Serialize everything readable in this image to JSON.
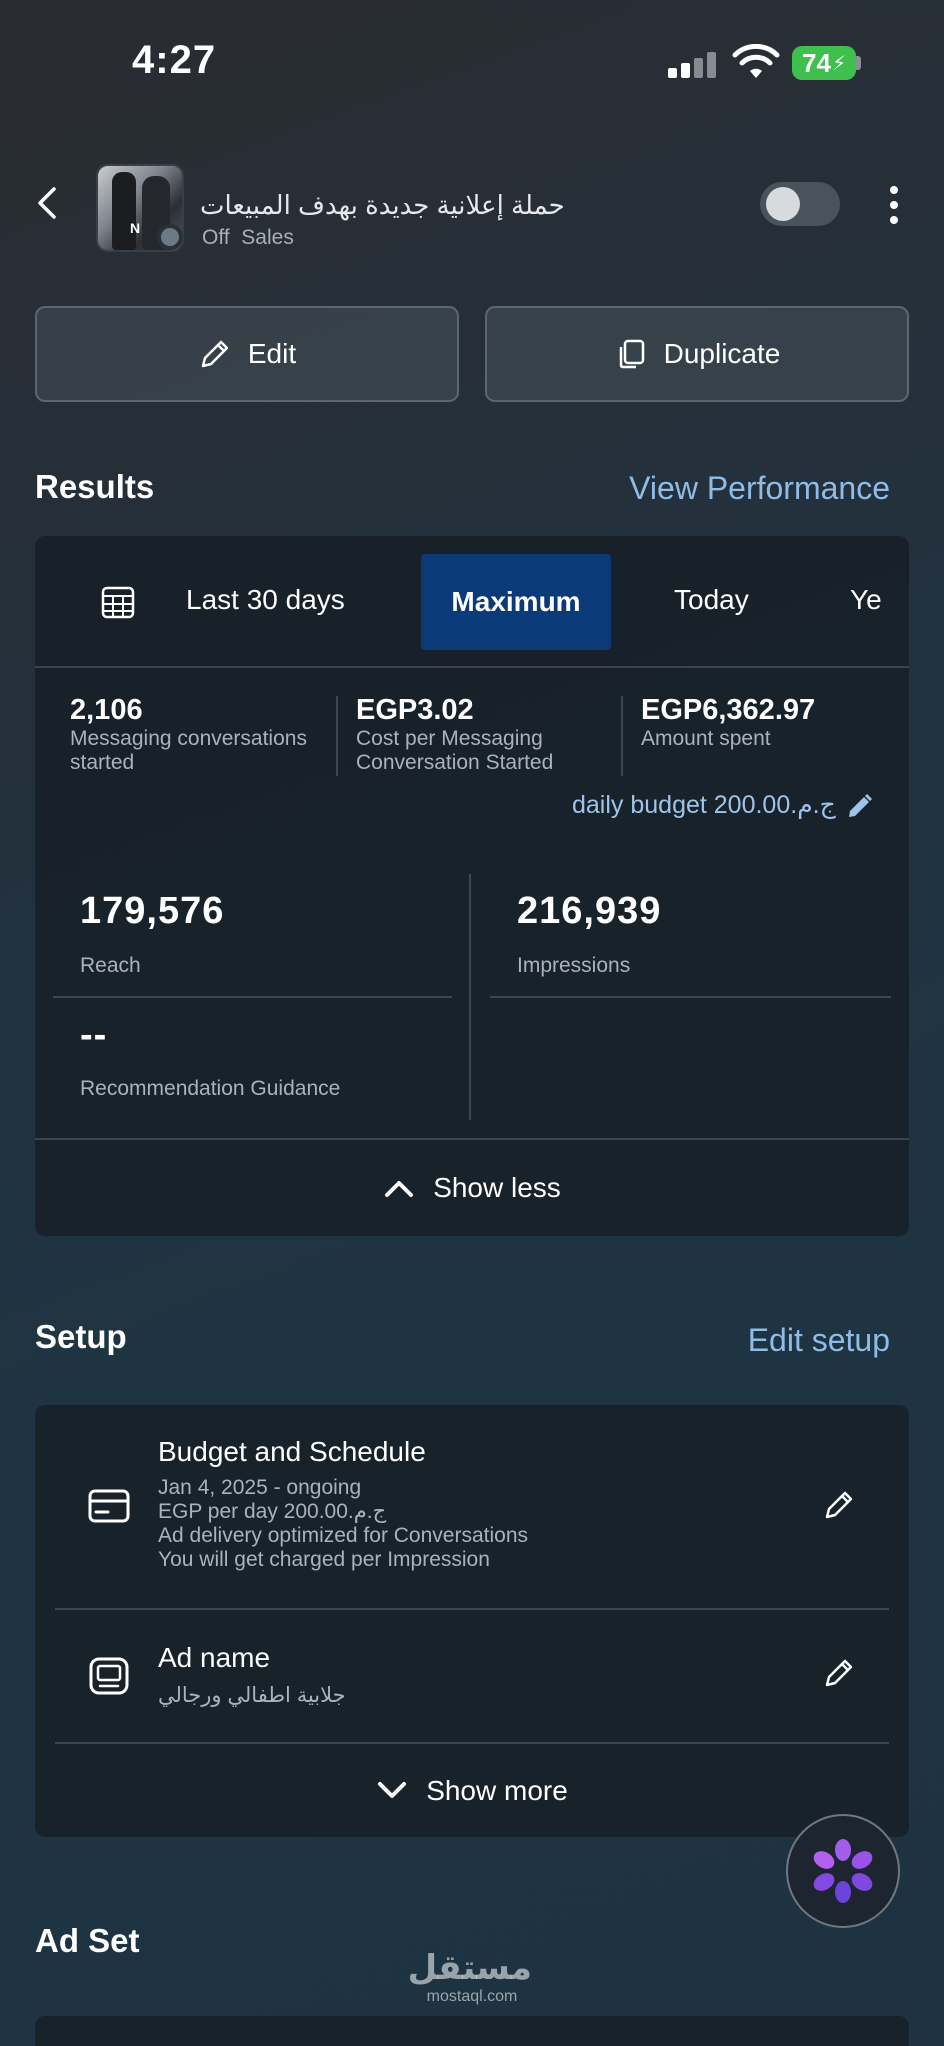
{
  "status_bar": {
    "time": "4:27",
    "battery": "74"
  },
  "header": {
    "campaign_title": "حملة إعلانية جديدة بهدف المبيعات",
    "campaign_status": "Off",
    "campaign_objective": "Sales"
  },
  "actions": {
    "edit_label": "Edit",
    "duplicate_label": "Duplicate"
  },
  "results": {
    "title": "Results",
    "view_performance": "View Performance",
    "tabs": [
      "Last 30 days",
      "Maximum",
      "Today",
      "Ye"
    ],
    "active_tab": "Maximum",
    "metrics": [
      {
        "value": "2,106",
        "label_1": "Messaging conversations",
        "label_2": "started"
      },
      {
        "value": "EGP3.02",
        "label_1": "Cost per Messaging",
        "label_2": "Conversation Started"
      },
      {
        "value": "EGP6,362.97",
        "label_1": "Amount spent",
        "label_2": ""
      }
    ],
    "daily_budget": "daily budget 200.00.ج.م",
    "reach": {
      "value": "179,576",
      "label": "Reach"
    },
    "impressions": {
      "value": "216,939",
      "label": "Impressions"
    },
    "recommendation": {
      "value": "--",
      "label": "Recommendation Guidance"
    },
    "show_less": "Show less"
  },
  "setup": {
    "title": "Setup",
    "edit_setup": "Edit setup",
    "budget": {
      "title": "Budget and Schedule",
      "line_1": "Jan 4, 2025 - ongoing",
      "line_2": "EGP per day 200.00.ج.م",
      "line_3": "Ad delivery optimized for Conversations",
      "line_4": "You will get charged per Impression"
    },
    "ad_name": {
      "title": "Ad name",
      "value": "جلابية اطفالي ورجالي"
    },
    "show_more": "Show more"
  },
  "ad_set": {
    "title": "Ad Set"
  },
  "watermark": {
    "arabic": "مستقل",
    "latin": "mostaql.com"
  },
  "colors": {
    "accent_link": "#8fbbe6",
    "active_tab": "#0b3a78",
    "battery": "#3fbf4d"
  }
}
